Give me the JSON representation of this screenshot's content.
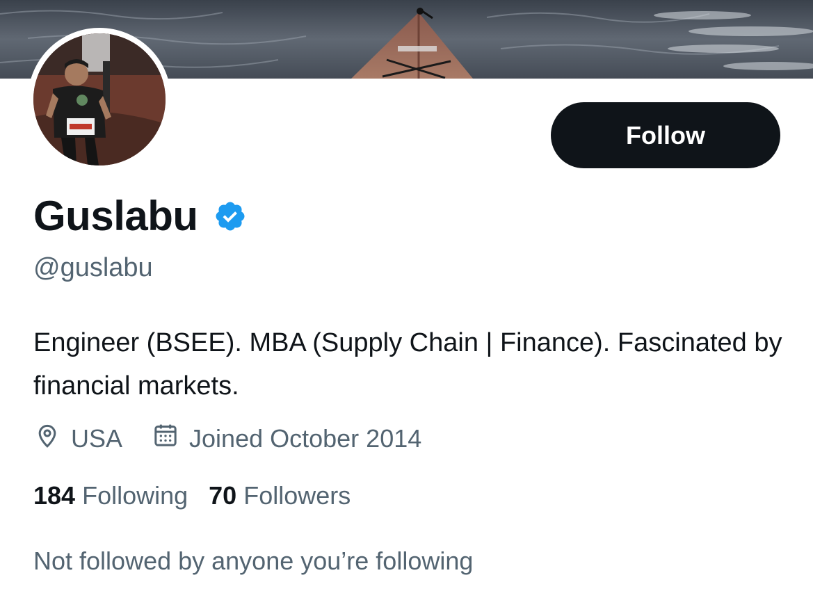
{
  "profile": {
    "display_name": "Guslabu",
    "handle": "@guslabu",
    "verified": true,
    "bio": "Engineer (BSEE). MBA (Supply Chain | Finance). Fascinated by financial markets.",
    "location": "USA",
    "joined": "Joined October 2014",
    "following_count": "184",
    "following_label": "Following",
    "followers_count": "70",
    "followers_label": "Followers",
    "followed_by_text": "Not followed by anyone you’re following"
  },
  "actions": {
    "follow_label": "Follow"
  },
  "icons": {
    "verified": "verified-badge-icon",
    "location": "location-pin-icon",
    "calendar": "calendar-icon"
  },
  "colors": {
    "text_primary": "#0f1419",
    "text_secondary": "#536471",
    "verified_blue": "#1d9bf0",
    "button_bg": "#0f1419",
    "button_text": "#ffffff"
  }
}
